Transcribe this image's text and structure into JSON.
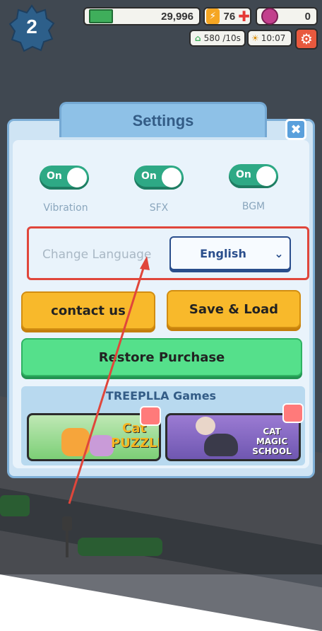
{
  "hud": {
    "level": "2",
    "cash": "29,996",
    "energy": "76",
    "gems": "0",
    "income": "580 /10s",
    "time": "10:07"
  },
  "settings": {
    "title": "Settings",
    "toggles": [
      {
        "label": "Vibration",
        "state": "On"
      },
      {
        "label": "SFX",
        "state": "On"
      },
      {
        "label": "BGM",
        "state": "On"
      }
    ],
    "change_language_label": "Change Language",
    "language_value": "English",
    "contact_label": "contact us",
    "save_load_label": "Save & Load",
    "restore_label": "Restore Purchase",
    "games_title": "TREEPLLA Games",
    "game1_logo": "Cat PUZZLE",
    "game2_logo": "CAT MAGIC SCHOOL"
  },
  "colors": {
    "toggle_on": "#2ea985",
    "accent_orange": "#f8b92b",
    "accent_green": "#55e08b",
    "highlight_red": "#e0463b"
  },
  "icons": {
    "close": "close-icon",
    "chevron": "chevron-down-icon",
    "settings": "gear-icon"
  }
}
